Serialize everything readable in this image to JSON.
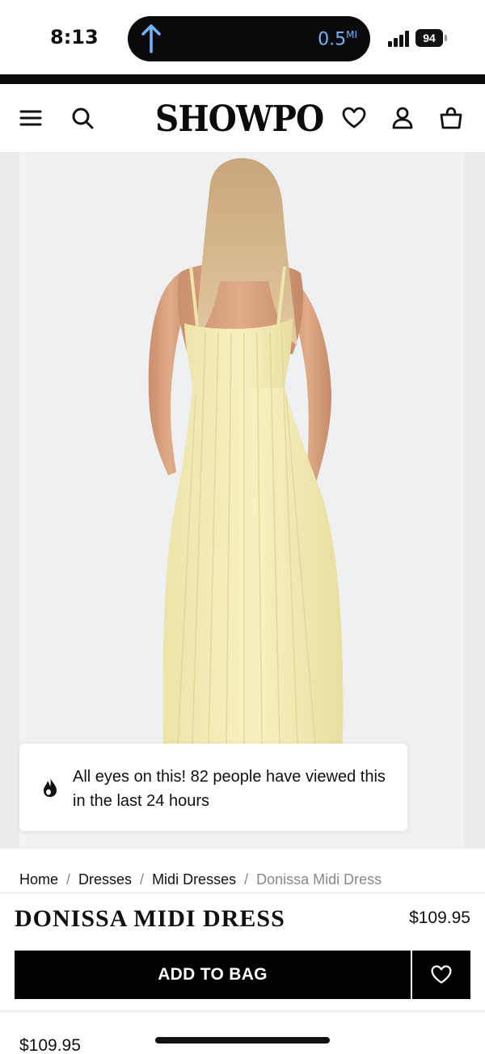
{
  "status_bar": {
    "time": "8:13",
    "nav_distance": "0.5",
    "nav_unit": "MI",
    "battery": "94"
  },
  "header": {
    "logo": "SHOWPO",
    "icons": [
      "menu-icon",
      "search-icon",
      "heart-icon",
      "user-icon",
      "bag-icon"
    ]
  },
  "toast": {
    "text": "All eyes on this! 82 people have viewed this in the last 24 hours",
    "icon": "flame-icon"
  },
  "breadcrumb": {
    "items": [
      "Home",
      "Dresses",
      "Midi Dresses"
    ],
    "current": "Donissa Midi Dress",
    "separator": "/"
  },
  "product": {
    "title": "DONISSA MIDI DRESS",
    "price": "$109.95",
    "dress_color": "#f5efb9"
  },
  "actions": {
    "add_to_bag": "ADD TO BAG",
    "wishlist_icon": "heart-outline-icon"
  },
  "sticky": {
    "price": "$109.95"
  }
}
